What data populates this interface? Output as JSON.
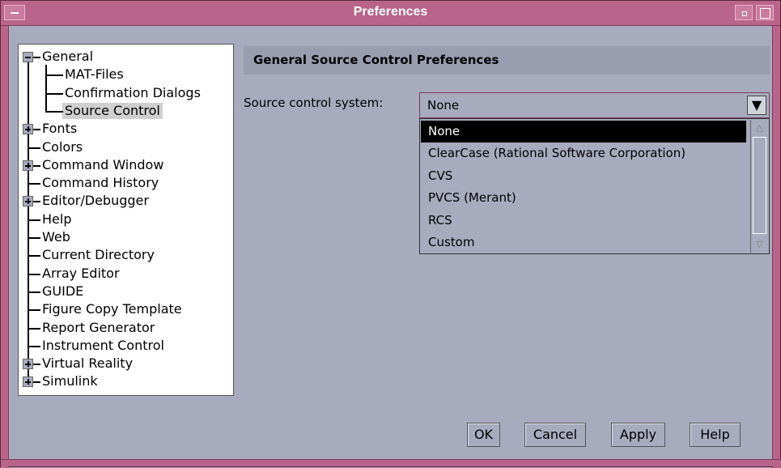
{
  "window": {
    "title": "Preferences"
  },
  "tree": {
    "items": [
      {
        "label": "General",
        "expander": "minus"
      },
      {
        "label": "MAT-Files"
      },
      {
        "label": "Confirmation Dialogs"
      },
      {
        "label": "Source Control",
        "selected": true
      },
      {
        "label": "Fonts",
        "expander": "plus"
      },
      {
        "label": "Colors"
      },
      {
        "label": "Command Window",
        "expander": "plus"
      },
      {
        "label": "Command History"
      },
      {
        "label": "Editor/Debugger",
        "expander": "plus"
      },
      {
        "label": "Help"
      },
      {
        "label": "Web"
      },
      {
        "label": "Current Directory"
      },
      {
        "label": "Array Editor"
      },
      {
        "label": "GUIDE"
      },
      {
        "label": "Figure Copy Template"
      },
      {
        "label": "Report Generator"
      },
      {
        "label": "Instrument Control"
      },
      {
        "label": "Virtual Reality",
        "expander": "plus"
      },
      {
        "label": "Simulink",
        "expander": "plus"
      }
    ]
  },
  "panel": {
    "header": "General Source Control Preferences",
    "source_label": "Source control system:",
    "combo_value": "None",
    "options": [
      "None",
      "ClearCase (Rational Software Corporation)",
      "CVS",
      "PVCS (Merant)",
      "RCS",
      "Custom"
    ]
  },
  "buttons": {
    "ok": "OK",
    "cancel": "Cancel",
    "apply": "Apply",
    "help": "Help"
  },
  "colors": {
    "titlebar": "#b9648a",
    "background": "#a8abbe",
    "selection": "#000000"
  }
}
